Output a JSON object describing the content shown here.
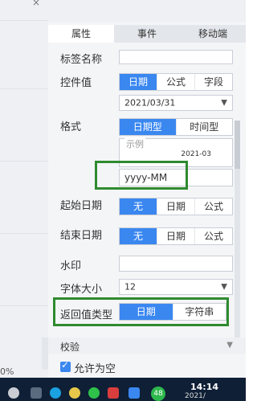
{
  "left": {
    "zoom_pct": "0%",
    "close_glyph": "×"
  },
  "tabs": [
    "属性",
    "事件",
    "移动端"
  ],
  "fields": {
    "tag_name_label": "标签名称",
    "control_value_label": "控件值",
    "control_value_options": [
      "日期",
      "公式",
      "字段"
    ],
    "control_value_date": "2021/03/31",
    "format_label": "格式",
    "format_options": [
      "日期型",
      "时间型"
    ],
    "sample_legend": "示例",
    "sample_preview": "2021-03",
    "format_value": "yyyy-MM",
    "start_date_label": "起始日期",
    "start_date_options": [
      "无",
      "日期",
      "公式"
    ],
    "end_date_label": "结束日期",
    "end_date_options": [
      "无",
      "日期",
      "公式"
    ],
    "watermark_label": "水印",
    "font_size_label": "字体大小",
    "font_size_value": "12",
    "return_type_label": "返回值类型",
    "return_type_options": [
      "日期",
      "字符串"
    ]
  },
  "section": {
    "validate_title": "校验",
    "allow_empty_label": "允许为空"
  },
  "taskbar": {
    "time": "14:14",
    "date": "2021/",
    "badge": "48"
  },
  "colors": {
    "accent": "#3a87f0",
    "highlight": "#2f8a2f"
  }
}
